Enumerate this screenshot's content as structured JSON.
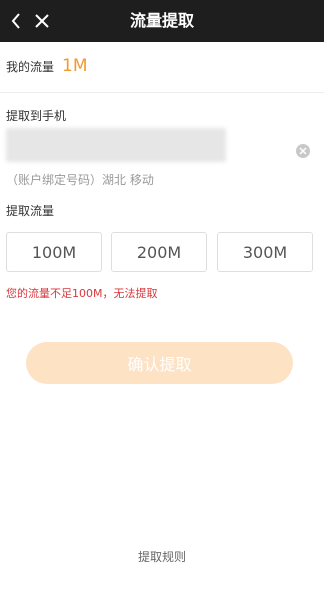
{
  "header": {
    "title": "流量提取"
  },
  "balance": {
    "label": "我的流量",
    "value": "1M",
    "value_color": "#f29a2e"
  },
  "phone_section": {
    "label": "提取到手机",
    "info": "（账户绑定号码）湖北 移动"
  },
  "amount_section": {
    "label": "提取流量",
    "options": [
      "100M",
      "200M",
      "300M"
    ]
  },
  "warning": "您的流量不足100M，无法提取",
  "confirm_button": "确认提取",
  "rules_link": "提取规则",
  "colors": {
    "topbar": "#1e1e1e",
    "accent": "#f29a2e",
    "warning": "#d9373c",
    "confirm_disabled": "#fde2c4"
  }
}
